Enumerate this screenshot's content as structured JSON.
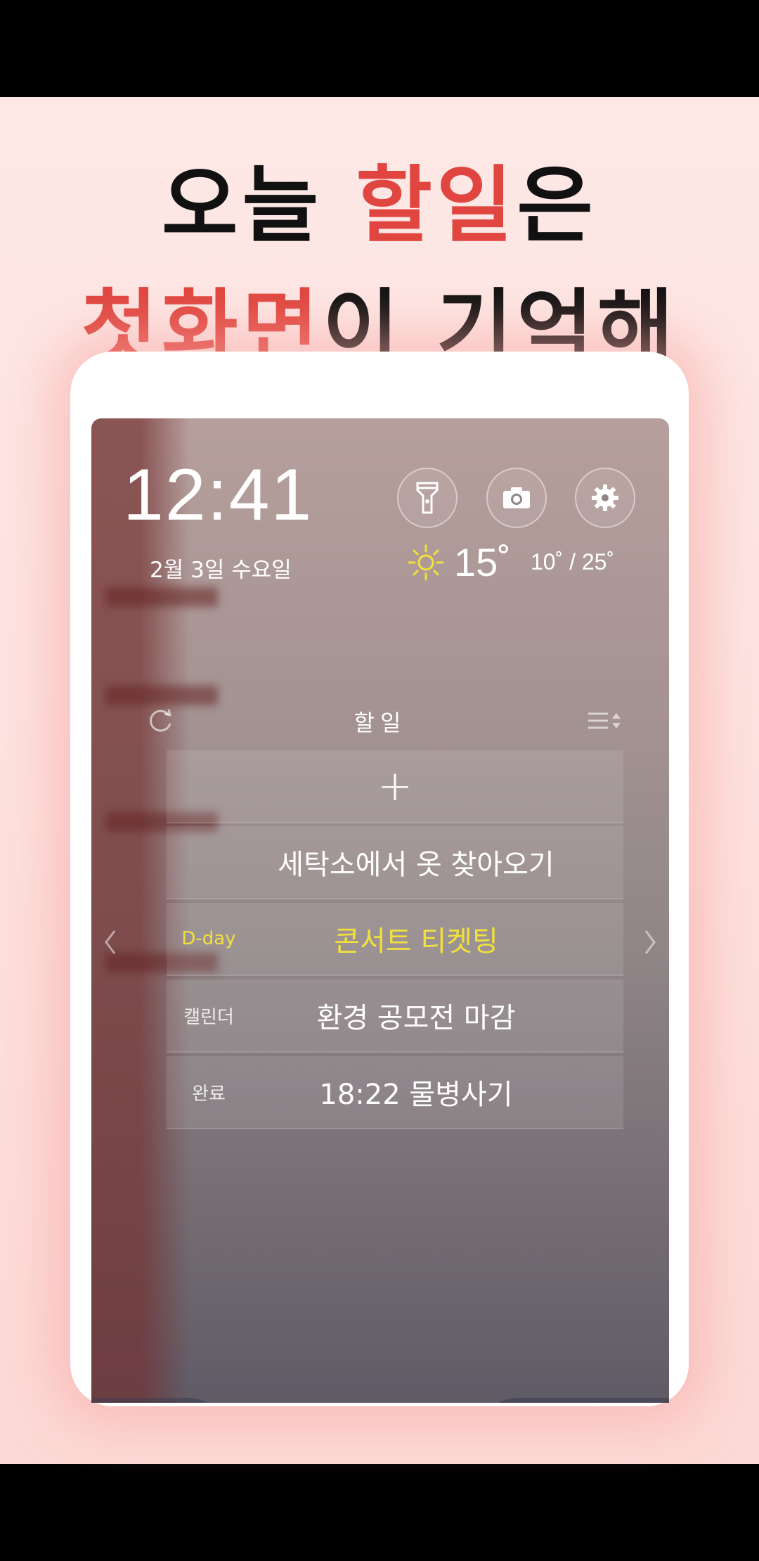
{
  "promo": {
    "line1_part1": "오늘 ",
    "line1_highlight": "할일",
    "line1_part2": "은",
    "line2_highlight": "첫화면",
    "line2_part2": "이 기억해",
    "highlight_color": "#e0463f"
  },
  "lockscreen": {
    "time": "12:41",
    "date": "2월 3일 수요일",
    "buttons": [
      {
        "icon": "flashlight-icon"
      },
      {
        "icon": "camera-icon"
      },
      {
        "icon": "gear-icon"
      }
    ],
    "weather": {
      "icon": "sun-icon",
      "temp": "15˚",
      "range": "10˚ / 25˚"
    }
  },
  "todo": {
    "title": "할일",
    "add_symbol": "+",
    "items": [
      {
        "tag": "",
        "text": "세탁소에서 옷 찾아오기"
      },
      {
        "tag": "D-day",
        "text": "콘서트 티켓팅",
        "color": "#f2e13a"
      },
      {
        "tag": "캘린더",
        "text": "환경 공모전 마감"
      },
      {
        "tag": "완료",
        "text": "18:22 물병사기"
      }
    ]
  },
  "bottom_bar": {
    "left_icon": "calendar-icon",
    "right_icon": "unlock-icon"
  }
}
